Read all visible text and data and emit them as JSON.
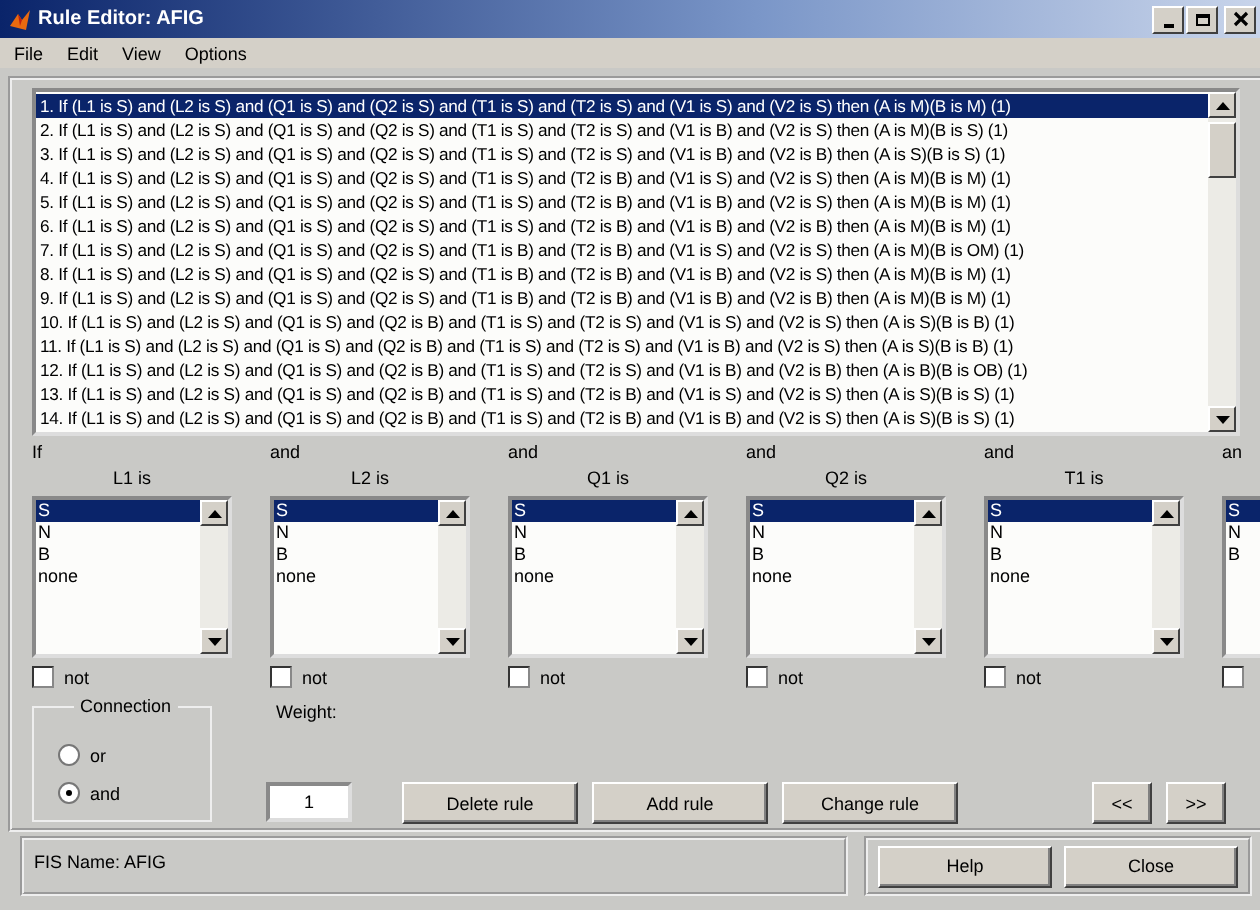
{
  "window": {
    "title": "Rule Editor: AFIG"
  },
  "menu": [
    "File",
    "Edit",
    "View",
    "Options"
  ],
  "rules": [
    {
      "text": "1. If (L1 is S) and (L2 is S) and (Q1 is S) and (Q2 is S) and (T1 is S) and (T2 is S) and (V1 is S) and (V2 is S) then (A is M)(B is M) (1)",
      "selected": true
    },
    {
      "text": "2. If (L1 is S) and (L2 is S) and (Q1 is S) and (Q2 is S) and (T1 is S) and (T2 is S) and (V1 is B) and (V2 is S) then (A is M)(B is S) (1)",
      "selected": false
    },
    {
      "text": "3. If (L1 is S) and (L2 is S) and (Q1 is S) and (Q2 is S) and (T1 is S) and (T2 is S) and (V1 is B) and (V2 is B) then (A is S)(B is S) (1)",
      "selected": false
    },
    {
      "text": "4. If (L1 is S) and (L2 is S) and (Q1 is S) and (Q2 is S) and (T1 is S) and (T2 is B) and (V1 is S) and (V2 is S) then (A is M)(B is M) (1)",
      "selected": false
    },
    {
      "text": "5. If (L1 is S) and (L2 is S) and (Q1 is S) and (Q2 is S) and (T1 is S) and (T2 is B) and (V1 is B) and (V2 is S) then (A is M)(B is M) (1)",
      "selected": false
    },
    {
      "text": "6. If (L1 is S) and (L2 is S) and (Q1 is S) and (Q2 is S) and (T1 is S) and (T2 is B) and (V1 is B) and (V2 is B) then (A is M)(B is M) (1)",
      "selected": false
    },
    {
      "text": "7. If (L1 is S) and (L2 is S) and (Q1 is S) and (Q2 is S) and (T1 is B) and (T2 is B) and (V1 is S) and (V2 is S) then (A is M)(B is OM) (1)",
      "selected": false
    },
    {
      "text": "8. If (L1 is S) and (L2 is S) and (Q1 is S) and (Q2 is S) and (T1 is B) and (T2 is B) and (V1 is B) and (V2 is S) then (A is M)(B is M) (1)",
      "selected": false
    },
    {
      "text": "9. If (L1 is S) and (L2 is S) and (Q1 is S) and (Q2 is S) and (T1 is B) and (T2 is B) and (V1 is B) and (V2 is B) then (A is M)(B is M) (1)",
      "selected": false
    },
    {
      "text": "10. If (L1 is S) and (L2 is S) and (Q1 is S) and (Q2 is B) and (T1 is S) and (T2 is S) and (V1 is S) and (V2 is S) then (A is S)(B is B) (1)",
      "selected": false
    },
    {
      "text": "11. If (L1 is S) and (L2 is S) and (Q1 is S) and (Q2 is B) and (T1 is S) and (T2 is S) and (V1 is B) and (V2 is S) then (A is S)(B is B) (1)",
      "selected": false
    },
    {
      "text": "12. If (L1 is S) and (L2 is S) and (Q1 is S) and (Q2 is B) and (T1 is S) and (T2 is S) and (V1 is B) and (V2 is B) then (A is B)(B is OB) (1)",
      "selected": false
    },
    {
      "text": "13. If (L1 is S) and (L2 is S) and (Q1 is S) and (Q2 is B) and (T1 is S) and (T2 is B) and (V1 is S) and (V2 is S) then (A is S)(B is S) (1)",
      "selected": false
    },
    {
      "text": "14. If (L1 is S) and (L2 is S) and (Q1 is S) and (Q2 is B) and (T1 is S) and (T2 is B) and (V1 is B) and (V2 is S) then (A is S)(B is S) (1)",
      "selected": false
    }
  ],
  "antecedents": [
    {
      "kind": "full",
      "connector": "If",
      "label": "L1 is",
      "items": [
        {
          "text": "S",
          "selected": true
        },
        {
          "text": "N",
          "selected": false
        },
        {
          "text": "B",
          "selected": false
        },
        {
          "text": "none",
          "selected": false
        }
      ],
      "negate_label": "not",
      "negated": false
    },
    {
      "kind": "full",
      "connector": "and",
      "label": "L2 is",
      "items": [
        {
          "text": "S",
          "selected": true
        },
        {
          "text": "N",
          "selected": false
        },
        {
          "text": "B",
          "selected": false
        },
        {
          "text": "none",
          "selected": false
        }
      ],
      "negate_label": "not",
      "negated": false
    },
    {
      "kind": "full",
      "connector": "and",
      "label": "Q1 is",
      "items": [
        {
          "text": "S",
          "selected": true
        },
        {
          "text": "N",
          "selected": false
        },
        {
          "text": "B",
          "selected": false
        },
        {
          "text": "none",
          "selected": false
        }
      ],
      "negate_label": "not",
      "negated": false
    },
    {
      "kind": "full",
      "connector": "and",
      "label": "Q2 is",
      "items": [
        {
          "text": "S",
          "selected": true
        },
        {
          "text": "N",
          "selected": false
        },
        {
          "text": "B",
          "selected": false
        },
        {
          "text": "none",
          "selected": false
        }
      ],
      "negate_label": "not",
      "negated": false
    },
    {
      "kind": "full",
      "connector": "and",
      "label": "T1 is",
      "items": [
        {
          "text": "S",
          "selected": true
        },
        {
          "text": "N",
          "selected": false
        },
        {
          "text": "B",
          "selected": false
        },
        {
          "text": "none",
          "selected": false
        }
      ],
      "negate_label": "not",
      "negated": false
    },
    {
      "kind": "partial",
      "connector": "an",
      "items": [
        {
          "text": "S",
          "selected": true
        },
        {
          "text": "N",
          "selected": false
        },
        {
          "text": "B",
          "selected": false
        }
      ],
      "negated": false
    }
  ],
  "connection": {
    "title": "Connection",
    "options": [
      {
        "label": "or",
        "selected": false
      },
      {
        "label": "and",
        "selected": true
      }
    ]
  },
  "weight": {
    "label": "Weight:",
    "value": "1"
  },
  "buttons": [
    "Delete rule",
    "Add rule",
    "Change rule"
  ],
  "nav_buttons": [
    "<<",
    ">>"
  ],
  "status": "FIS Name: AFIG",
  "footer_buttons": [
    "Help",
    "Close"
  ]
}
